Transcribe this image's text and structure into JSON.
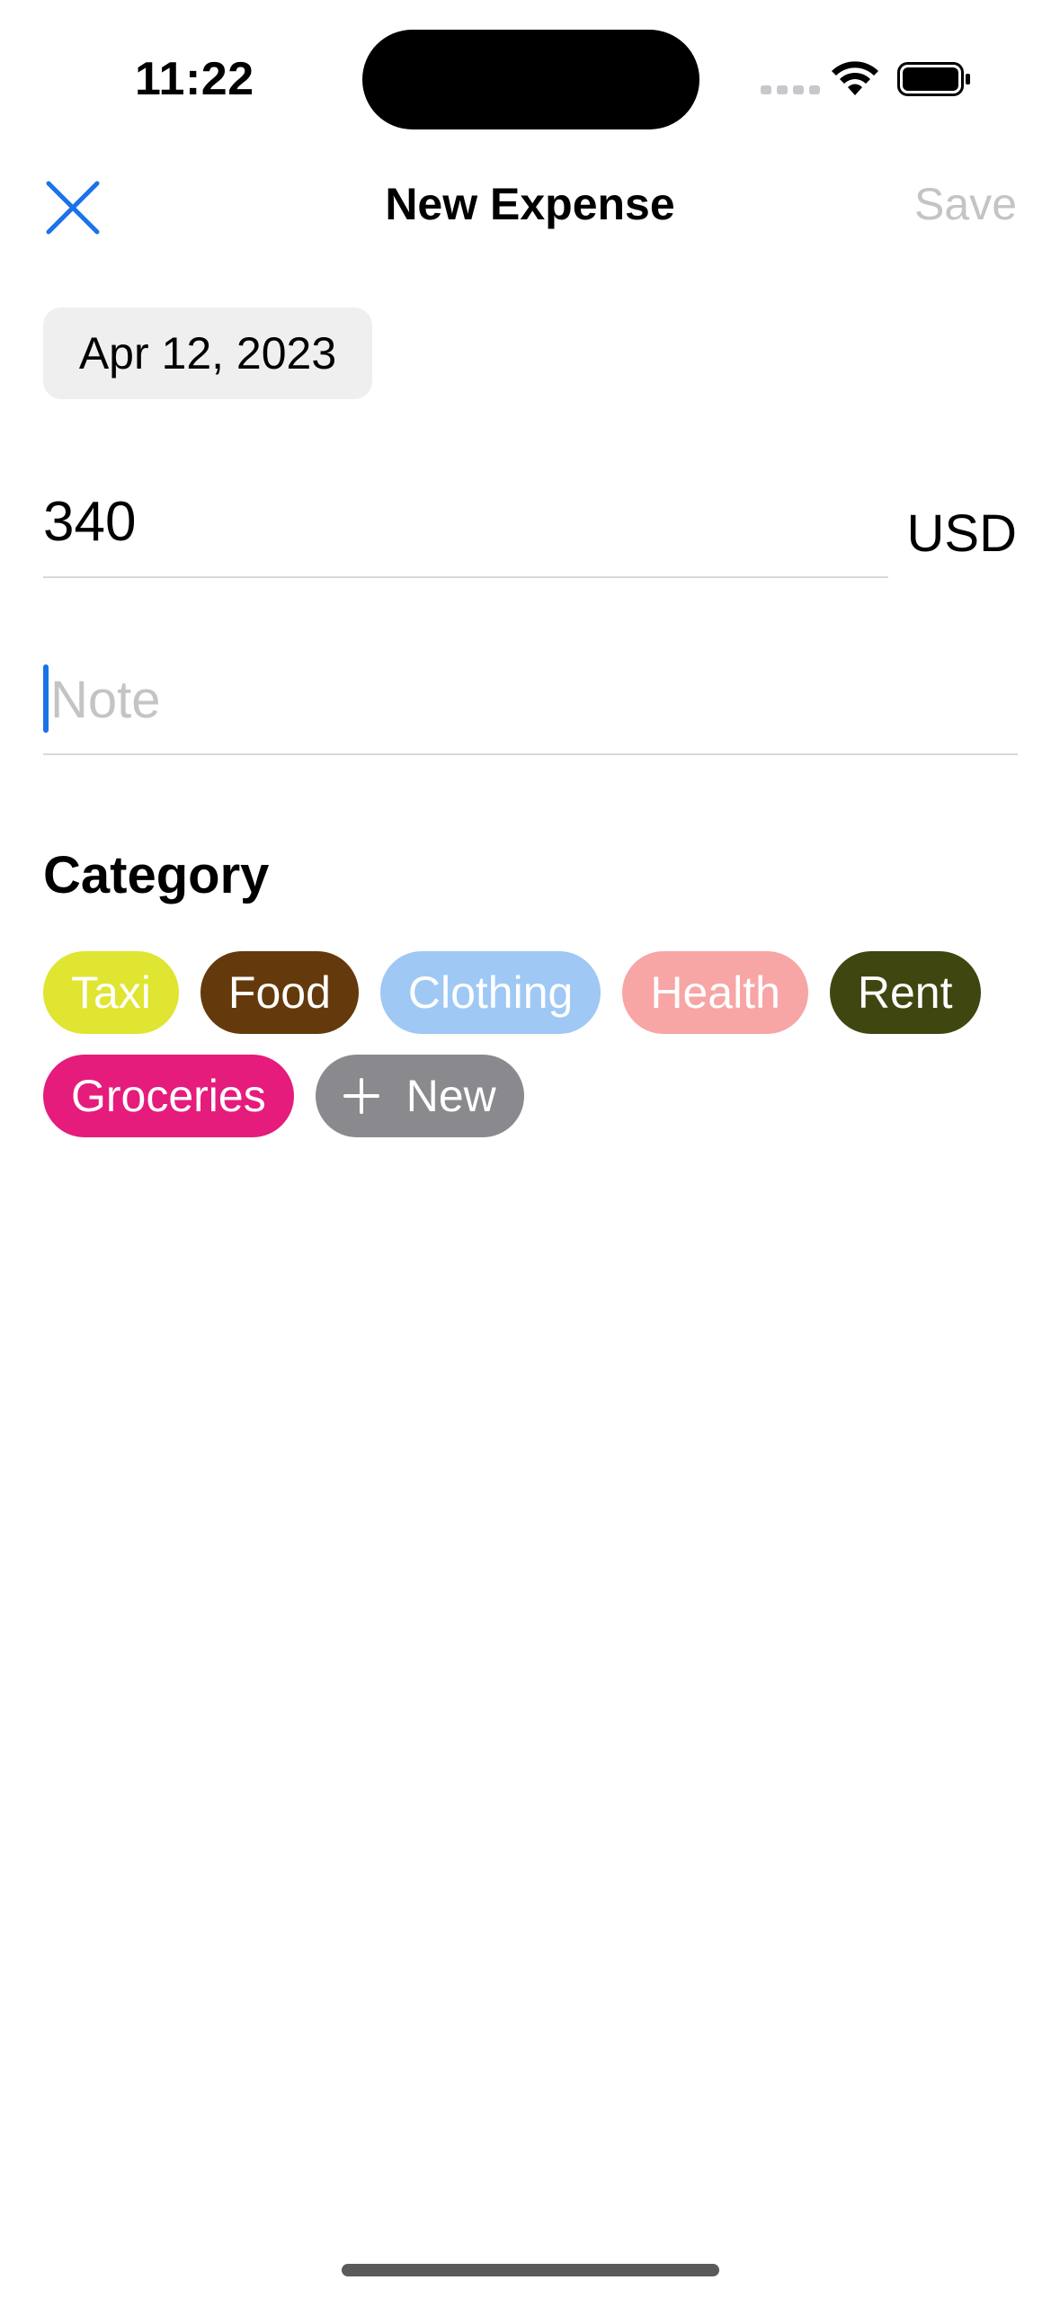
{
  "status_bar": {
    "time": "11:22",
    "icons": [
      "signal-icon",
      "wifi-icon",
      "battery-icon"
    ]
  },
  "nav": {
    "close_icon": "close-icon",
    "title": "New Expense",
    "save_label": "Save",
    "save_enabled": false
  },
  "form": {
    "date": "Apr 12, 2023",
    "amount": "340",
    "currency": "USD",
    "note_value": "",
    "note_placeholder": "Note"
  },
  "category": {
    "heading": "Category",
    "chips": [
      {
        "label": "Taxi",
        "color": "#dfe530"
      },
      {
        "label": "Food",
        "color": "#643a0c"
      },
      {
        "label": "Clothing",
        "color": "#9fc8f4"
      },
      {
        "label": "Health",
        "color": "#f7a5a5"
      },
      {
        "label": "Rent",
        "color": "#404610"
      },
      {
        "label": "Groceries",
        "color": "#e51c7c"
      }
    ],
    "new_chip": {
      "label": "New",
      "icon": "plus-icon",
      "color": "#8a8a8e"
    }
  },
  "colors": {
    "accent": "#1a73e8",
    "placeholder": "#c4c4c6",
    "divider": "#d9d9dc"
  }
}
